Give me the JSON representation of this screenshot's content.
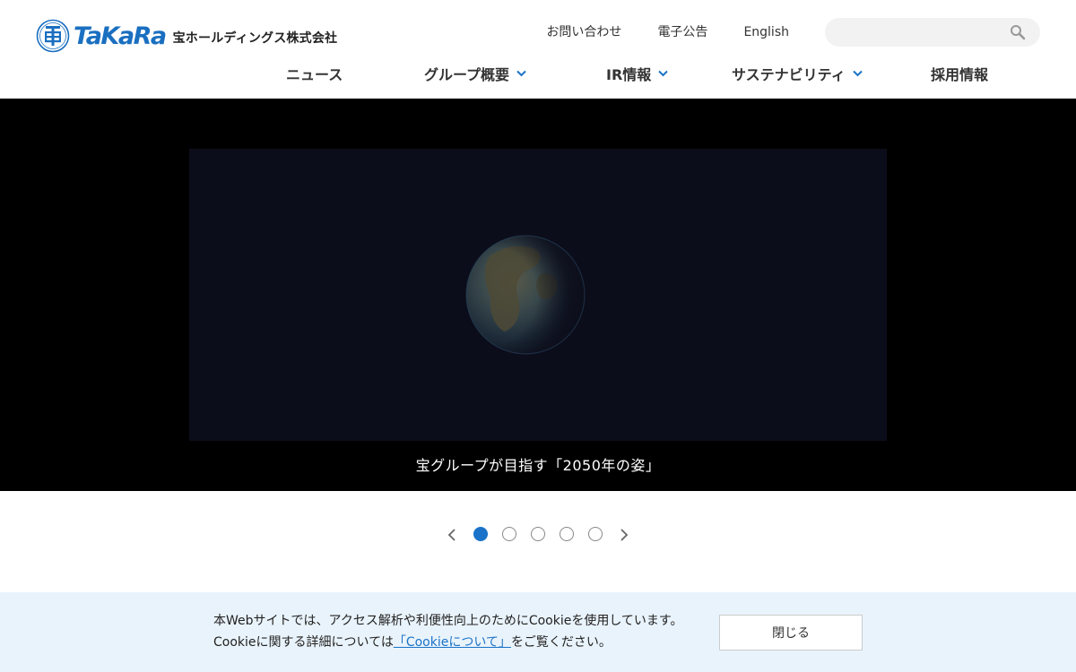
{
  "brand": {
    "wordmark": "TaKaRa",
    "company": "宝ホールディングス株式会社",
    "accent_color": "#1a73c8",
    "icon": "takara-logo-mark-icon"
  },
  "utility_nav": {
    "contact": "お問い合わせ",
    "notices": "電子公告",
    "english": "English"
  },
  "search": {
    "placeholder": "",
    "icon": "search-icon"
  },
  "main_nav": {
    "items": [
      {
        "label": "ニュース",
        "has_dropdown": false
      },
      {
        "label": "グループ概要",
        "has_dropdown": true
      },
      {
        "label": "IR情報",
        "has_dropdown": true
      },
      {
        "label": "サステナビリティ",
        "has_dropdown": true
      },
      {
        "label": "採用情報",
        "has_dropdown": false
      }
    ],
    "dropdown_icon": "chevron-down-icon"
  },
  "hero": {
    "caption": "宝グループが目指す「2050年の姿」",
    "media": "earth-video-icon"
  },
  "carousel": {
    "total_slides": 5,
    "active_slide": 1,
    "prev_icon": "chevron-left-icon",
    "next_icon": "chevron-right-icon"
  },
  "cookie_banner": {
    "line1": "本Webサイトでは、アクセス解析や利便性向上のためにCookieを使用しています。",
    "line2_before": "Cookieに関する詳細については",
    "link_text": "「Cookieについて」",
    "line2_after": "をご覧ください。",
    "close_label": "閉じる"
  }
}
